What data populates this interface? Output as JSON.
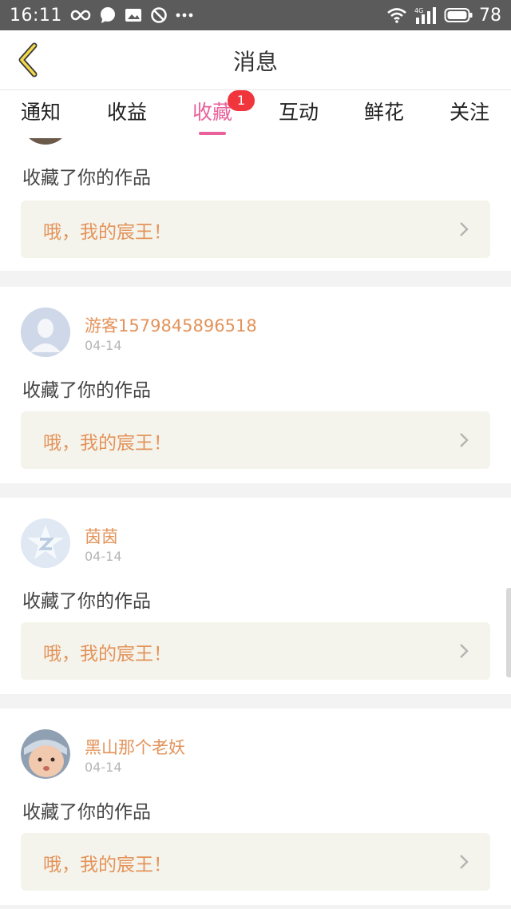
{
  "status_bar": {
    "time": "16:11",
    "battery": "78",
    "network": "4G"
  },
  "header": {
    "title": "消息"
  },
  "tabs": [
    {
      "label": "通知",
      "active": false
    },
    {
      "label": "收益",
      "active": false
    },
    {
      "label": "收藏",
      "active": true,
      "badge": "1"
    },
    {
      "label": "互动",
      "active": false
    },
    {
      "label": "鲜花",
      "active": false
    },
    {
      "label": "关注",
      "active": false
    }
  ],
  "messages": [
    {
      "user": "",
      "date": "",
      "action": "收藏了你的作品",
      "work_title": "哦，我的宸王！"
    },
    {
      "user": "游客1579845896518",
      "date": "04-14",
      "action": "收藏了你的作品",
      "work_title": "哦，我的宸王！",
      "avatar": "default-person-avatar"
    },
    {
      "user": "茵茵",
      "date": "04-14",
      "action": "收藏了你的作品",
      "work_title": "哦，我的宸王！",
      "avatar": "qq-star-avatar"
    },
    {
      "user": "黑山那个老妖",
      "date": "04-14",
      "action": "收藏了你的作品",
      "work_title": "哦，我的宸王！",
      "avatar": "baby-photo-avatar"
    }
  ],
  "colors": {
    "accent": "#e8619b",
    "badge": "#f0353d",
    "name": "#e3935a",
    "work_box_bg": "#f5f4ec"
  }
}
